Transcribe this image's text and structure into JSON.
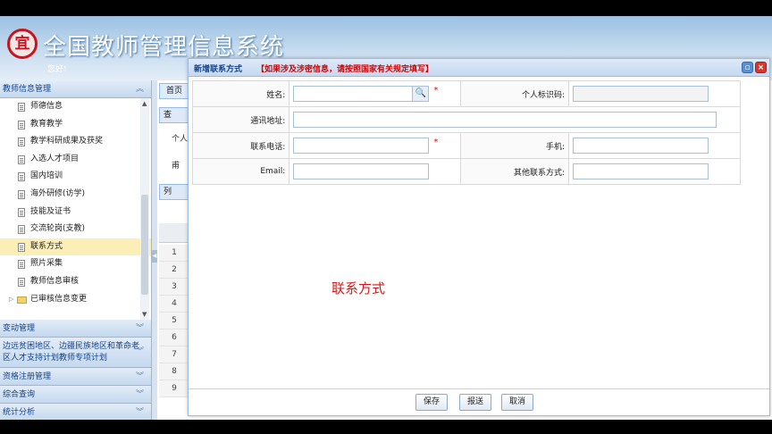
{
  "app": {
    "logo_char": "宜",
    "title": "全国教师管理信息系统",
    "greeting": "您好!"
  },
  "sidebar": {
    "section_top": "教师信息管理",
    "tree_items": [
      {
        "label": "师德信息",
        "selected": false
      },
      {
        "label": "教育教学",
        "selected": false
      },
      {
        "label": "教学科研成果及获奖",
        "selected": false
      },
      {
        "label": "入选人才项目",
        "selected": false
      },
      {
        "label": "国内培训",
        "selected": false
      },
      {
        "label": "海外研修(访学)",
        "selected": false
      },
      {
        "label": "技能及证书",
        "selected": false
      },
      {
        "label": "交流轮岗(支教)",
        "selected": false
      },
      {
        "label": "联系方式",
        "selected": true
      },
      {
        "label": "照片采集",
        "selected": false
      }
    ],
    "tree_item_review": "教师信息审核",
    "tree_folder": "已审核信息变更",
    "sections": [
      "变动管理",
      "边远贫困地区、边疆民族地区和革命老区人才支持计划教师专项计划",
      "资格注册管理",
      "综合查询",
      "统计分析"
    ]
  },
  "background": {
    "tab": "首页",
    "panel1": "查",
    "row1": "个人",
    "row2": "甫",
    "panel2": "列",
    "grid_rows": [
      "1",
      "2",
      "3",
      "4",
      "5",
      "6",
      "7",
      "8",
      "9"
    ]
  },
  "dialog": {
    "title": "新增联系方式",
    "warning": "【如果涉及涉密信息，请按照国家有关规定填写】",
    "fields": {
      "name_label": "姓名:",
      "id_label": "个人标识码:",
      "address_label": "通讯地址:",
      "phone_label": "联系电话:",
      "mobile_label": "手机:",
      "email_label": "Email:",
      "other_label": "其他联系方式:"
    },
    "required_mark": "*",
    "center_label": "联系方式",
    "buttons": {
      "save": "保存",
      "submit": "报送",
      "cancel": "取消"
    }
  },
  "colors": {
    "accent": "#15428b",
    "warning": "#d40000",
    "selected_row": "#fbeeb6"
  }
}
